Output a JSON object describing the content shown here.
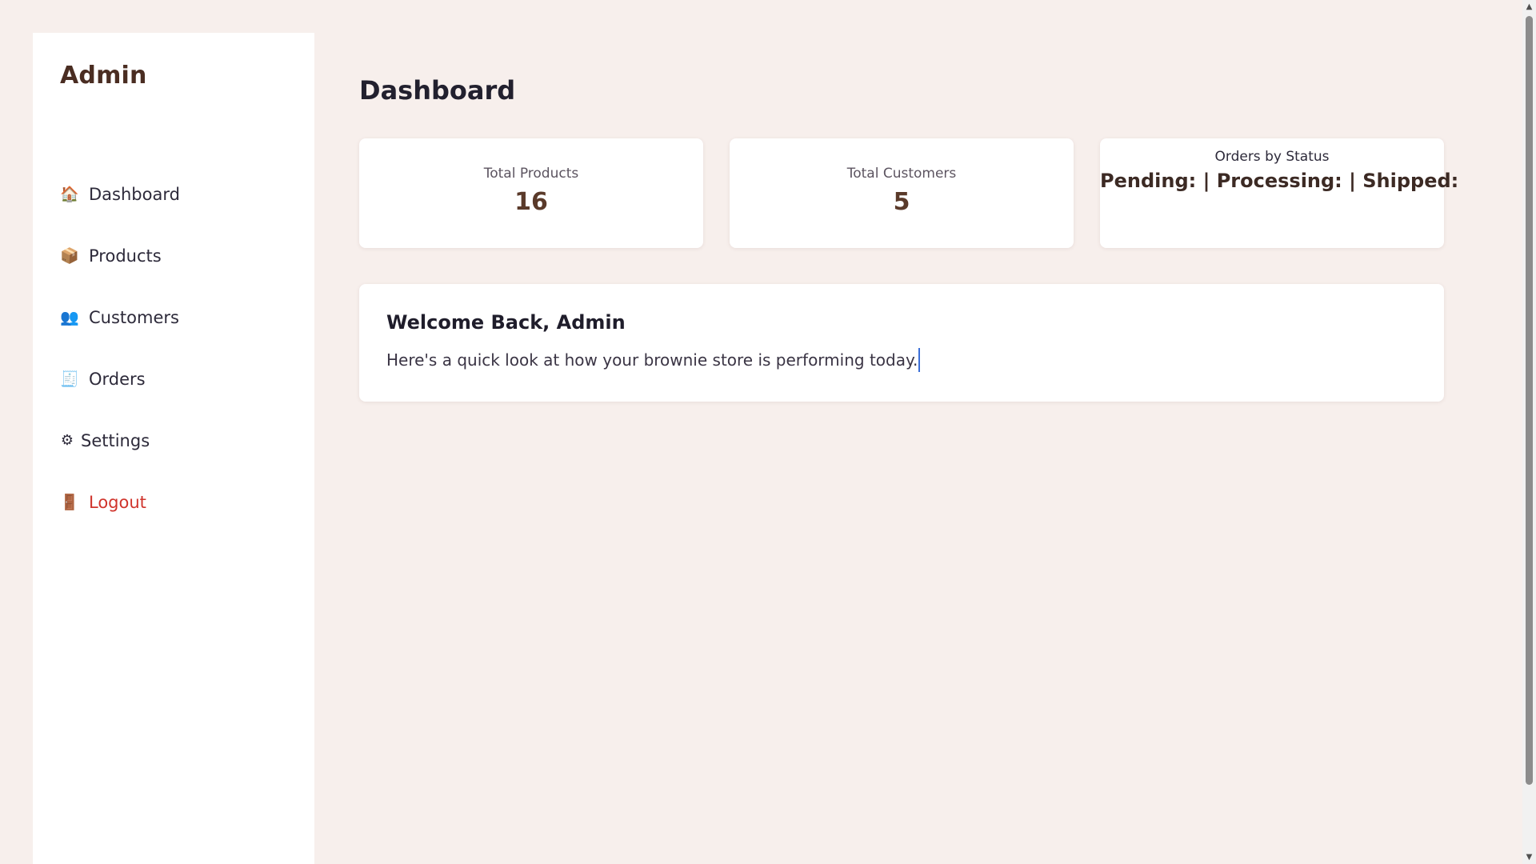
{
  "sidebar": {
    "brand": "Admin",
    "items": [
      {
        "icon": "🏠",
        "icon_name": "house-icon",
        "label": "Dashboard"
      },
      {
        "icon": "📦",
        "icon_name": "package-icon",
        "label": "Products"
      },
      {
        "icon": "👥",
        "icon_name": "users-icon",
        "label": "Customers"
      },
      {
        "icon": "🧾",
        "icon_name": "receipt-icon",
        "label": "Orders"
      },
      {
        "icon": "⚙",
        "icon_name": "gear-icon",
        "label": "Settings"
      },
      {
        "icon": "🚪",
        "icon_name": "door-icon",
        "label": "Logout"
      }
    ]
  },
  "main": {
    "title": "Dashboard",
    "stats": [
      {
        "label": "Total Products",
        "value": "16"
      },
      {
        "label": "Total Customers",
        "value": "5"
      }
    ],
    "orders_status": {
      "label": "Orders by Status",
      "line": "Pending: | Processing: | Shipped:"
    },
    "welcome": {
      "title": "Welcome Back, Admin",
      "text": "Here's a quick look at how your brownie store is performing today."
    }
  },
  "colors": {
    "background": "#f7efec",
    "logout": "#d0342c",
    "brand": "#4a2d22",
    "stat_value": "#5a3a2a"
  }
}
